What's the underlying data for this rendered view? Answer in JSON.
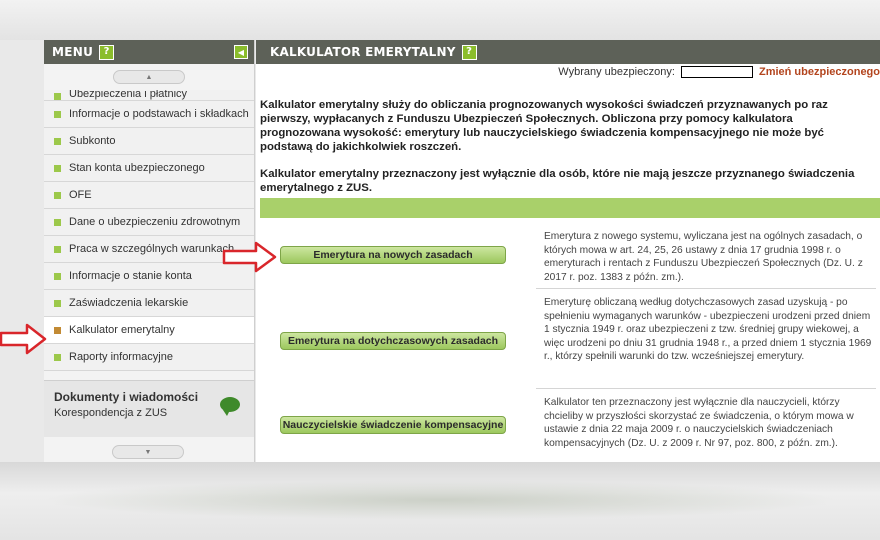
{
  "sidebar": {
    "menu_title": "MENU",
    "help": "?",
    "items": [
      {
        "label": "Ubezpieczenia i płatnicy",
        "partial": true
      },
      {
        "label": "Informacje o podstawach i składkach"
      },
      {
        "label": "Subkonto"
      },
      {
        "label": "Stan konta ubezpieczonego"
      },
      {
        "label": "OFE"
      },
      {
        "label": "Dane o ubezpieczeniu zdrowotnym"
      },
      {
        "label": "Praca w szczególnych warunkach"
      },
      {
        "label": "Informacje o stanie konta"
      },
      {
        "label": "Zaświadczenia lekarskie"
      },
      {
        "label": "Kalkulator emerytalny",
        "active": true
      },
      {
        "label": "Raporty informacyjne"
      }
    ],
    "docs_title": "Dokumenty i wiadomości",
    "docs_sub": "Korespondencja z ZUS"
  },
  "main": {
    "title": "KALKULATOR EMERYTALNY",
    "help": "?",
    "insured_label": "Wybrany ubezpieczony:",
    "change_label": "Zmień ubezpieczonego",
    "intro_p1_a": "Kalkulator emerytalny służy do obliczania prognozowanych wysokości świadczeń przyznawanych po raz pierwszy, wypłacanych z Funduszu Ubezpieczeń Społecznych. Obliczona przy pomocy kalkulatora prognozowana wysokość: emerytury lub nauczycielskiego świadczenia kompensacyjnego nie może być podstawą do jakichkolwiek roszczeń.",
    "intro_p2": "Kalkulator emerytalny przeznaczony jest wyłącznie dla osób, które nie mają jeszcze przyznanego świadczenia emerytalnego z ZUS.",
    "options": [
      {
        "button": "Emerytura na nowych zasadach",
        "desc": "Emerytura z nowego systemu, wyliczana jest na ogólnych zasadach, o których mowa w art. 24, 25, 26 ustawy z dnia 17 grudnia 1998 r. o emeryturach i rentach z Funduszu Ubezpieczeń Społecznych (Dz. U. z 2017 r. poz. 1383 z późn. zm.)."
      },
      {
        "button": "Emerytura na dotychczasowych zasadach",
        "desc": "Emeryturę obliczaną według dotychczasowych zasad uzyskują - po spełnieniu wymaganych warunków - ubezpieczeni urodzeni przed dniem 1 stycznia 1949 r. oraz ubezpieczeni z tzw. średniej grupy wiekowej, a więc urodzeni po dniu 31 grudnia 1948 r., a przed dniem 1 stycznia 1969 r., którzy spełnili warunki do tzw. wcześniejszej emerytury."
      },
      {
        "button": "Nauczycielskie świadczenie kompensacyjne",
        "desc": "Kalkulator ten przeznaczony jest wyłącznie dla nauczycieli, którzy chcieliby w przyszłości skorzystać ze świadczenia, o którym mowa w ustawie z dnia 22 maja 2009 r. o nauczycielskich świadczeniach kompensacyjnych (Dz. U. z 2009 r. Nr 97, poz. 800, z późn. zm.)."
      }
    ]
  },
  "colors": {
    "header": "#5d6158",
    "accent_green": "#8bbd2c",
    "arrow_red": "#d9262b",
    "change_link": "#b3451e"
  }
}
